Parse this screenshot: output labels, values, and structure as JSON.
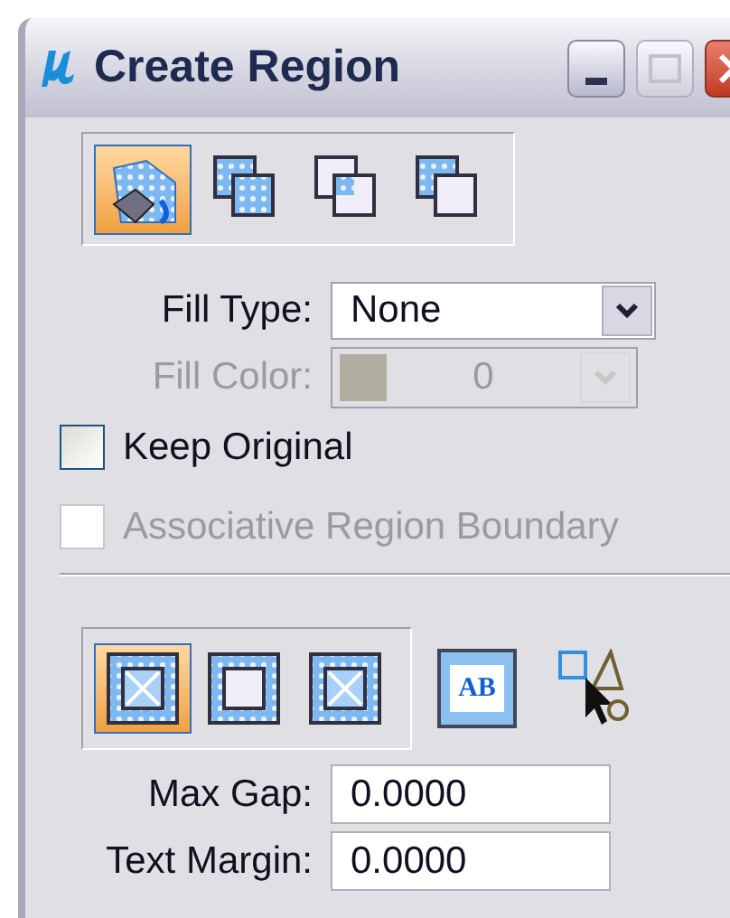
{
  "window": {
    "title": "Create Region"
  },
  "mode_buttons": [
    {
      "kind": "flood",
      "selected": true
    },
    {
      "kind": "union",
      "selected": false
    },
    {
      "kind": "intersection",
      "selected": false
    },
    {
      "kind": "difference",
      "selected": false
    }
  ],
  "fill_type": {
    "label": "Fill Type:",
    "value": "None",
    "disabled": false
  },
  "fill_color": {
    "label": "Fill Color:",
    "value": "0",
    "disabled": true
  },
  "checkboxes": [
    {
      "label": "Keep Original",
      "checked": false,
      "disabled": false
    },
    {
      "label": "Associative Region Boundary",
      "checked": false,
      "disabled": true
    }
  ],
  "boundary_buttons": [
    {
      "kind": "crossed",
      "selected": true
    },
    {
      "kind": "plain",
      "selected": false
    },
    {
      "kind": "crossed",
      "selected": false
    }
  ],
  "text_button": {
    "label": "AB"
  },
  "fields": [
    {
      "label": "Max Gap:",
      "value": "0.0000"
    },
    {
      "label": "Text Margin:",
      "value": "0.0000"
    }
  ]
}
